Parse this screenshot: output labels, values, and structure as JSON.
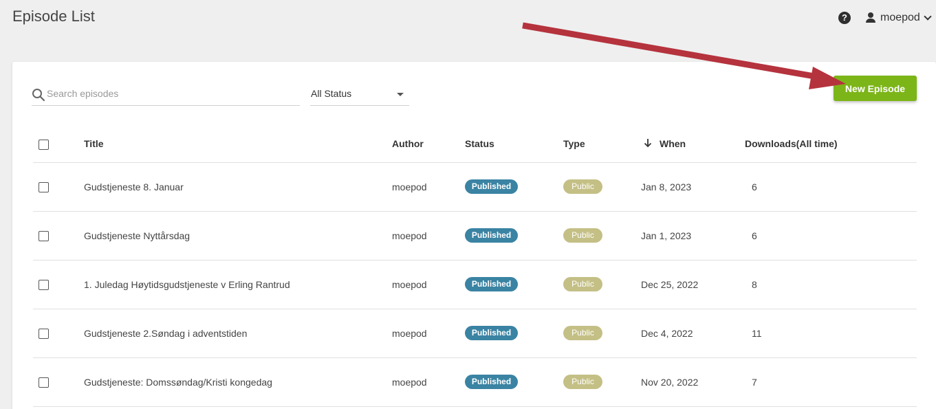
{
  "header": {
    "title": "Episode List",
    "help_icon": "?",
    "user_name": "moepod"
  },
  "toolbar": {
    "search_placeholder": "Search episodes",
    "status_filter": "All Status",
    "new_episode_label": "New Episode"
  },
  "colors": {
    "new_episode_button": "#7cb518",
    "published_badge": "#3a83a3",
    "public_badge": "#c4bf85",
    "annotation_arrow": "#b5333d"
  },
  "table": {
    "columns": {
      "title": "Title",
      "author": "Author",
      "status": "Status",
      "type": "Type",
      "when": "When",
      "downloads": "Downloads(All time)"
    },
    "rows": [
      {
        "title": "Gudstjeneste 8. Januar",
        "author": "moepod",
        "status": "Published",
        "type": "Public",
        "when": "Jan 8, 2023",
        "downloads": "6"
      },
      {
        "title": "Gudstjeneste Nyttårsdag",
        "author": "moepod",
        "status": "Published",
        "type": "Public",
        "when": "Jan 1, 2023",
        "downloads": "6"
      },
      {
        "title": "1. Juledag Høytidsgudstjeneste v Erling Rantrud",
        "author": "moepod",
        "status": "Published",
        "type": "Public",
        "when": "Dec 25, 2022",
        "downloads": "8"
      },
      {
        "title": "Gudstjeneste 2.Søndag i adventstiden",
        "author": "moepod",
        "status": "Published",
        "type": "Public",
        "when": "Dec 4, 2022",
        "downloads": "11"
      },
      {
        "title": "Gudstjeneste: Domssøndag/Kristi kongedag",
        "author": "moepod",
        "status": "Published",
        "type": "Public",
        "when": "Nov 20, 2022",
        "downloads": "7"
      }
    ]
  }
}
